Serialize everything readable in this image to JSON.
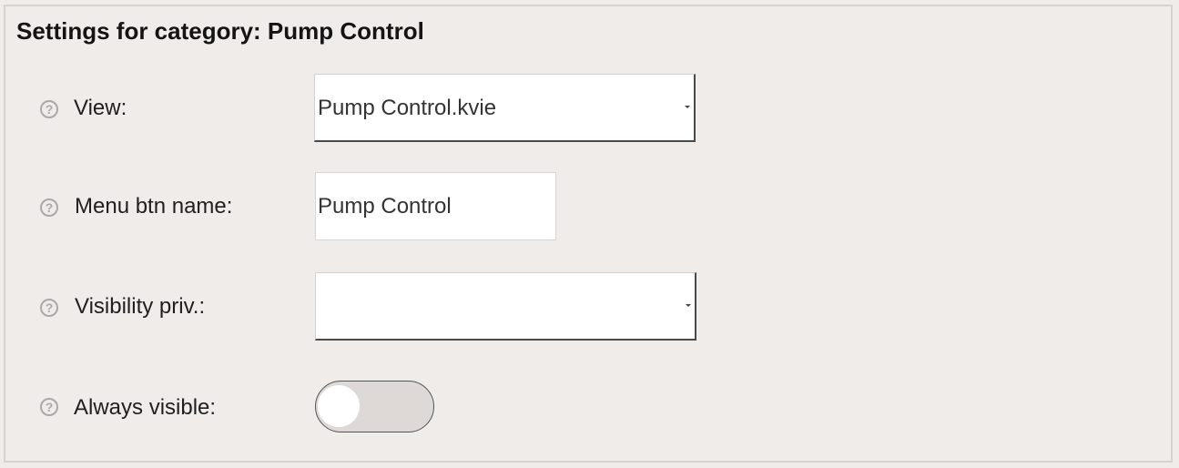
{
  "panel": {
    "title": "Settings for category: Pump Control"
  },
  "fields": {
    "view": {
      "help_glyph": "?",
      "label": "View:",
      "value": "Pump Control.kvie"
    },
    "menu_btn_name": {
      "help_glyph": "?",
      "label": "Menu btn name:",
      "value": "Pump Control"
    },
    "visibility_priv": {
      "help_glyph": "?",
      "label": "Visibility priv.:",
      "value": ""
    },
    "always_visible": {
      "help_glyph": "?",
      "label": "Always visible:",
      "on": false
    }
  },
  "icons": {
    "help": "help-circle-icon",
    "dropdown": "chevron-down-icon"
  },
  "colors": {
    "background": "#f0ecea",
    "panel_border": "#d8d3d0",
    "help_icon": "#a9a9a9",
    "toggle_off": "#ded9d7"
  }
}
